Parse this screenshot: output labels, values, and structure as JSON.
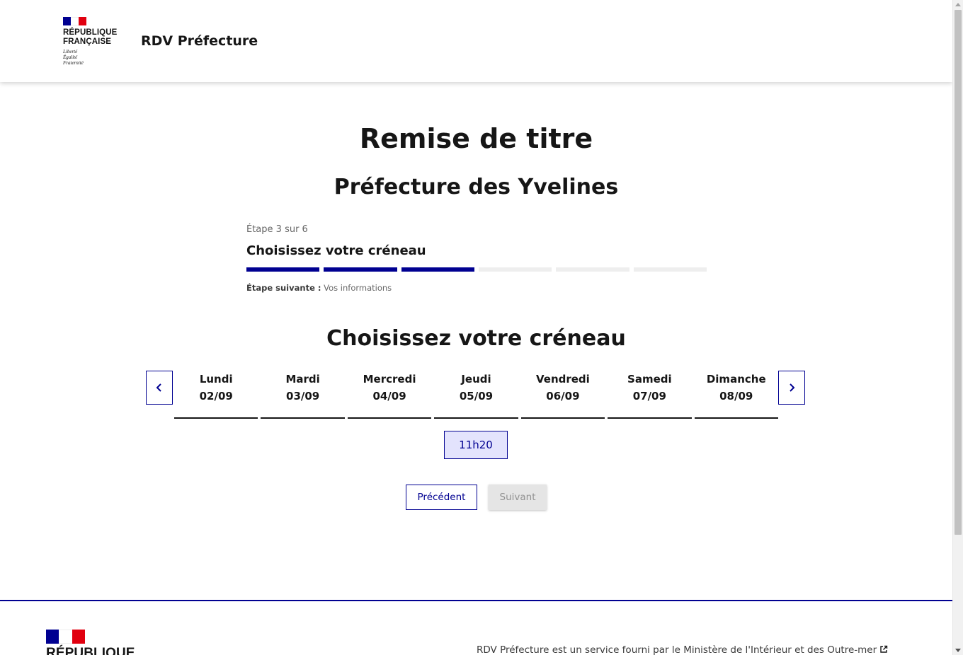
{
  "header": {
    "republic_name": "République\nFrançaise",
    "motto": "Liberté\nÉgalité\nFraternité",
    "service_title": "RDV Préfecture"
  },
  "main": {
    "title": "Remise de titre",
    "subtitle": "Préfecture des Yvelines"
  },
  "stepper": {
    "state": "Étape 3 sur 6",
    "current_title": "Choisissez votre créneau",
    "current_step": 3,
    "total_steps": 6,
    "next_label": "Étape suivante :",
    "next_value": "Vos informations"
  },
  "calendar": {
    "section_title": "Choisissez votre créneau",
    "days": [
      {
        "name": "Lundi",
        "date": "02/09"
      },
      {
        "name": "Mardi",
        "date": "03/09"
      },
      {
        "name": "Mercredi",
        "date": "04/09"
      },
      {
        "name": "Jeudi",
        "date": "05/09"
      },
      {
        "name": "Vendredi",
        "date": "06/09"
      },
      {
        "name": "Samedi",
        "date": "07/09"
      },
      {
        "name": "Dimanche",
        "date": "08/09"
      }
    ],
    "slot": "11h20",
    "prev_icon": "chevron-left-icon",
    "next_icon": "chevron-right-icon"
  },
  "actions": {
    "previous": "Précédent",
    "next": "Suivant"
  },
  "footer": {
    "republic_name": "République",
    "text": "RDV Préfecture est un service fourni par le Ministère de l'Intérieur et des Outre-mer",
    "link_icon": "external-link-icon"
  },
  "colors": {
    "primary": "#000091",
    "flag_red": "#e1000f",
    "slot_bg": "#e3e3fd",
    "disabled_bg": "#e5e5e5"
  }
}
